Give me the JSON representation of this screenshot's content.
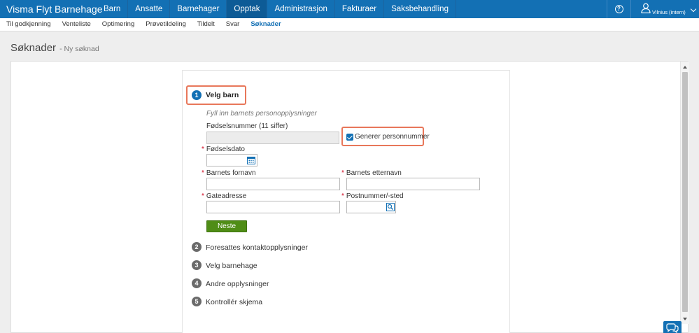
{
  "app": {
    "title": "Visma Flyt Barnehage"
  },
  "nav": {
    "items": [
      {
        "label": "Barn"
      },
      {
        "label": "Ansatte"
      },
      {
        "label": "Barnehager"
      },
      {
        "label": "Opptak"
      },
      {
        "label": "Administrasjon"
      },
      {
        "label": "Fakturaer"
      },
      {
        "label": "Saksbehandling"
      }
    ],
    "active": "Opptak"
  },
  "user": {
    "name": "Vilnius (intern)"
  },
  "subnav": {
    "items": [
      {
        "label": "Til godkjenning"
      },
      {
        "label": "Venteliste"
      },
      {
        "label": "Optimering"
      },
      {
        "label": "Prøvetildeling"
      },
      {
        "label": "Tildelt"
      },
      {
        "label": "Svar"
      },
      {
        "label": "Søknader"
      }
    ],
    "active": "Søknader"
  },
  "page": {
    "title": "Søknader",
    "subtitle": "- Ny søknad"
  },
  "steps": [
    {
      "number": "1",
      "label": "Velg barn"
    },
    {
      "number": "2",
      "label": "Foresattes kontaktopplysninger"
    },
    {
      "number": "3",
      "label": "Velg barnehage"
    },
    {
      "number": "4",
      "label": "Andre opplysninger"
    },
    {
      "number": "5",
      "label": "Kontrollér skjema"
    }
  ],
  "form": {
    "instruction": "Fyll inn barnets personopplysninger",
    "ssn_label": "Fødselsnummer (11 siffer)",
    "ssn_value": "",
    "generate_label": "Generer personnummer",
    "generate_checked": true,
    "required_marker": "*",
    "birthdate_label": "Fødselsdato",
    "birthdate_value": "",
    "firstname_label": "Barnets fornavn",
    "firstname_value": "",
    "lastname_label": "Barnets etternavn",
    "lastname_value": "",
    "address_label": "Gateadresse",
    "address_value": "",
    "postal_label": "Postnummer/-sted",
    "postal_value": "",
    "next_label": "Neste"
  },
  "colors": {
    "primary": "#1370b4",
    "nav_active": "#0d5b96",
    "next_button": "#4f8d16",
    "highlight": "#e8775a",
    "required": "#d0021b"
  },
  "icons": {
    "help": "help-circle-icon",
    "user": "user-icon",
    "user_menu": "chevron-down-icon",
    "calendar": "calendar-icon",
    "postal_lookup": "lookup-icon",
    "chat": "chat-icon"
  }
}
